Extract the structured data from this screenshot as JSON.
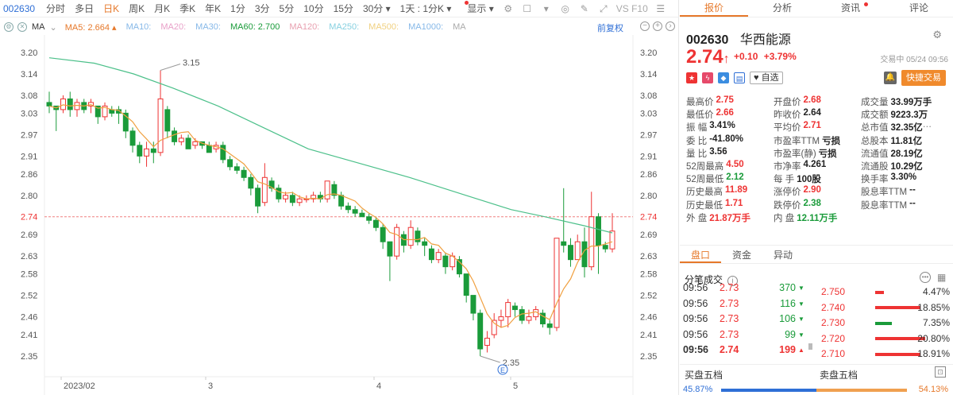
{
  "toolbar": {
    "code": "002630",
    "periods": [
      "分时",
      "多日",
      "日K",
      "周K",
      "月K",
      "季K",
      "年K",
      "1分",
      "3分",
      "5分",
      "10分",
      "15分",
      "30分"
    ],
    "active_period": "日K",
    "range_select": "1天 : 1分K",
    "display_label": "显示",
    "vs_label": "VS F10"
  },
  "ma_bar": {
    "ma_label": "MA",
    "items": [
      {
        "label": "MA5:",
        "value": "2.664",
        "color": "#e6782a"
      },
      {
        "label": "MA10:",
        "value": "",
        "color": "#86b8e8"
      },
      {
        "label": "MA20:",
        "value": "",
        "color": "#e8a0c8"
      },
      {
        "label": "MA30:",
        "value": "",
        "color": "#86b8e8"
      },
      {
        "label": "MA60:",
        "value": "2.700",
        "color": "#1a9b3a"
      },
      {
        "label": "MA120:",
        "value": "",
        "color": "#e8a0b0"
      },
      {
        "label": "MA250:",
        "value": "",
        "color": "#86d0e0"
      },
      {
        "label": "MA500:",
        "value": "",
        "color": "#f0d080"
      },
      {
        "label": "MA1000:",
        "value": "",
        "color": "#86b8e8"
      },
      {
        "label": "MA",
        "value": "",
        "color": "#aaa"
      }
    ],
    "fq_label": "前复权"
  },
  "chart_data": {
    "type": "candlestick",
    "y_ticks": [
      "3.20",
      "3.14",
      "3.08",
      "3.03",
      "2.97",
      "2.91",
      "2.86",
      "2.80",
      "2.74",
      "2.69",
      "2.63",
      "2.58",
      "2.52",
      "2.46",
      "2.41",
      "2.35"
    ],
    "x_ticks": [
      "2023/02",
      "3",
      "4",
      "5"
    ],
    "current_price": "2.74",
    "high_annotation": "3.15",
    "low_annotation": "2.35",
    "ma5_label": "MA5",
    "ma60_label": "MA60",
    "candles": [
      [
        3.06,
        3.05,
        3.03,
        3.09
      ],
      [
        3.05,
        3.04,
        2.98,
        3.05
      ],
      [
        3.04,
        3.07,
        3.03,
        3.08
      ],
      [
        3.07,
        3.04,
        3.02,
        3.09
      ],
      [
        3.04,
        3.06,
        3.02,
        3.07
      ],
      [
        3.06,
        3.04,
        3.03,
        3.07
      ],
      [
        3.05,
        3.06,
        3.03,
        3.07
      ],
      [
        3.05,
        3.02,
        3.0,
        3.05
      ],
      [
        3.02,
        3.05,
        3.01,
        3.06
      ],
      [
        3.04,
        3.03,
        3.02,
        3.05
      ],
      [
        3.04,
        3.03,
        3.0,
        3.05
      ],
      [
        3.03,
        2.98,
        2.96,
        3.04
      ],
      [
        2.98,
        2.94,
        2.92,
        2.99
      ],
      [
        2.94,
        2.91,
        2.89,
        2.95
      ],
      [
        2.91,
        2.93,
        2.88,
        2.95
      ],
      [
        2.93,
        2.92,
        2.89,
        2.95
      ],
      [
        2.92,
        3.07,
        2.91,
        3.15
      ],
      [
        3.04,
        2.98,
        2.96,
        3.05
      ],
      [
        2.98,
        2.95,
        2.94,
        2.99
      ],
      [
        2.95,
        2.96,
        2.94,
        2.97
      ],
      [
        2.96,
        2.93,
        2.93,
        2.97
      ],
      [
        2.94,
        2.95,
        2.93,
        2.96
      ],
      [
        2.95,
        2.94,
        2.93,
        2.95
      ],
      [
        2.94,
        2.92,
        2.92,
        2.95
      ],
      [
        2.93,
        2.94,
        2.92,
        2.95
      ],
      [
        2.94,
        2.9,
        2.89,
        2.95
      ],
      [
        2.9,
        2.88,
        2.87,
        2.91
      ],
      [
        2.88,
        2.87,
        2.86,
        2.89
      ],
      [
        2.87,
        2.85,
        2.84,
        2.88
      ],
      [
        2.85,
        2.82,
        2.8,
        2.86
      ],
      [
        2.82,
        2.77,
        2.75,
        2.83
      ],
      [
        2.78,
        2.85,
        2.77,
        2.89
      ],
      [
        2.84,
        2.82,
        2.81,
        2.85
      ],
      [
        2.82,
        2.79,
        2.78,
        2.83
      ],
      [
        2.79,
        2.8,
        2.78,
        2.81
      ],
      [
        2.8,
        2.78,
        2.77,
        2.81
      ],
      [
        2.78,
        2.79,
        2.77,
        2.8
      ],
      [
        2.79,
        2.79,
        2.78,
        2.8
      ],
      [
        2.79,
        2.8,
        2.78,
        2.81
      ],
      [
        2.8,
        2.79,
        2.78,
        2.81
      ],
      [
        2.79,
        2.84,
        2.78,
        2.84
      ],
      [
        2.83,
        2.8,
        2.79,
        2.84
      ],
      [
        2.8,
        2.77,
        2.76,
        2.81
      ],
      [
        2.77,
        2.76,
        2.75,
        2.78
      ],
      [
        2.76,
        2.75,
        2.74,
        2.77
      ],
      [
        2.75,
        2.74,
        2.74,
        2.76
      ],
      [
        2.74,
        2.73,
        2.72,
        2.75
      ],
      [
        2.73,
        2.71,
        2.7,
        2.74
      ],
      [
        2.71,
        2.67,
        2.65,
        2.72
      ],
      [
        2.67,
        2.63,
        2.56,
        2.67
      ],
      [
        2.63,
        2.71,
        2.62,
        2.72
      ],
      [
        2.69,
        2.66,
        2.64,
        2.7
      ],
      [
        2.66,
        2.71,
        2.65,
        2.73
      ],
      [
        2.7,
        2.67,
        2.66,
        2.71
      ],
      [
        2.67,
        2.66,
        2.63,
        2.68
      ],
      [
        2.65,
        2.62,
        2.61,
        2.66
      ],
      [
        2.62,
        2.64,
        2.61,
        2.65
      ],
      [
        2.63,
        2.6,
        2.58,
        2.64
      ],
      [
        2.6,
        2.63,
        2.59,
        2.64
      ],
      [
        2.62,
        2.58,
        2.57,
        2.63
      ],
      [
        2.58,
        2.52,
        2.5,
        2.58
      ],
      [
        2.52,
        2.47,
        2.45,
        2.52
      ],
      [
        2.47,
        2.37,
        2.35,
        2.48
      ],
      [
        2.38,
        2.4,
        2.36,
        2.42
      ],
      [
        2.41,
        2.45,
        2.4,
        2.47
      ],
      [
        2.45,
        2.46,
        2.43,
        2.48
      ],
      [
        2.46,
        2.5,
        2.43,
        2.51
      ],
      [
        2.49,
        2.48,
        2.46,
        2.5
      ],
      [
        2.48,
        2.45,
        2.44,
        2.49
      ],
      [
        2.45,
        2.46,
        2.44,
        2.48
      ],
      [
        2.46,
        2.48,
        2.45,
        2.49
      ],
      [
        2.47,
        2.44,
        2.43,
        2.48
      ],
      [
        2.44,
        2.43,
        2.41,
        2.45
      ],
      [
        2.43,
        2.68,
        2.42,
        2.68
      ],
      [
        2.67,
        2.66,
        2.64,
        2.82
      ],
      [
        2.66,
        2.62,
        2.6,
        2.68
      ],
      [
        2.62,
        2.67,
        2.62,
        2.69
      ],
      [
        2.67,
        2.6,
        2.57,
        2.71
      ],
      [
        2.6,
        2.74,
        2.59,
        2.81
      ],
      [
        2.74,
        2.66,
        2.58,
        2.75
      ],
      [
        2.66,
        2.65,
        2.64,
        2.67
      ],
      [
        2.65,
        2.7,
        2.64,
        2.75
      ]
    ]
  },
  "quote": {
    "code": "002630",
    "name": "华西能源",
    "price": "2.74",
    "change": "+0.10",
    "change_pct": "+3.79%",
    "trade_time": "交易中 05/24 09:56",
    "watch_label": "自选",
    "quick_trade_label": "快捷交易"
  },
  "right_tabs": [
    "报价",
    "分析",
    "资讯",
    "评论"
  ],
  "stats": [
    [
      {
        "l": "最高价",
        "v": "2.75",
        "c": "red"
      },
      {
        "l": "开盘价",
        "v": "2.68",
        "c": "red"
      },
      {
        "l": "成交量",
        "v": "33.99万手",
        "c": "dark"
      }
    ],
    [
      {
        "l": "最低价",
        "v": "2.66",
        "c": "red"
      },
      {
        "l": "昨收价",
        "v": "2.64",
        "c": "dark"
      },
      {
        "l": "成交额",
        "v": "9223.3万",
        "c": "dark"
      }
    ],
    [
      {
        "l": "振  幅",
        "v": "3.41%",
        "c": "dark"
      },
      {
        "l": "平均价",
        "v": "2.71",
        "c": "red"
      },
      {
        "l": "总市值",
        "v": "32.35亿",
        "c": "dark"
      }
    ],
    [
      {
        "l": "委  比",
        "v": "-41.80%",
        "c": "dark"
      },
      {
        "l": "市盈率TTM",
        "v": "亏损",
        "c": "dark"
      },
      {
        "l": "总股本",
        "v": "11.81亿",
        "c": "dark"
      }
    ],
    [
      {
        "l": "量  比",
        "v": "3.56",
        "c": "dark"
      },
      {
        "l": "市盈率(静)",
        "v": "亏损",
        "c": "dark"
      },
      {
        "l": "流通值",
        "v": "28.19亿",
        "c": "dark"
      }
    ],
    [
      {
        "l": "52周最高",
        "v": "4.50",
        "c": "red"
      },
      {
        "l": "市净率",
        "v": "4.261",
        "c": "dark"
      },
      {
        "l": "流通股",
        "v": "10.29亿",
        "c": "dark"
      }
    ],
    [
      {
        "l": "52周最低",
        "v": "2.12",
        "c": "green"
      },
      {
        "l": "每  手",
        "v": "100股",
        "c": "dark"
      },
      {
        "l": "换手率",
        "v": "3.30%",
        "c": "dark"
      }
    ],
    [
      {
        "l": "历史最高",
        "v": "11.89",
        "c": "red"
      },
      {
        "l": "涨停价",
        "v": "2.90",
        "c": "red"
      },
      {
        "l": "股息率TTM",
        "v": "--",
        "c": "dark"
      }
    ],
    [
      {
        "l": "历史最低",
        "v": "1.71",
        "c": "red"
      },
      {
        "l": "跌停价",
        "v": "2.38",
        "c": "green"
      },
      {
        "l": "股息率TTM",
        "v": "--",
        "c": "dark"
      }
    ],
    [
      {
        "l": "外  盘",
        "v": "21.87万手",
        "c": "red"
      },
      {
        "l": "内  盘",
        "v": "12.11万手",
        "c": "green"
      },
      {
        "l": "",
        "v": "",
        "c": "dark"
      }
    ]
  ],
  "sub_tabs": [
    "盘口",
    "资金",
    "异动"
  ],
  "fenbi": {
    "title": "分笔成交",
    "trades": [
      {
        "t": "09:56",
        "p": "2.73",
        "v": "370",
        "dir": "down"
      },
      {
        "t": "09:56",
        "p": "2.73",
        "v": "116",
        "dir": "down"
      },
      {
        "t": "09:56",
        "p": "2.73",
        "v": "106",
        "dir": "down"
      },
      {
        "t": "09:56",
        "p": "2.73",
        "v": "99",
        "dir": "down"
      },
      {
        "t": "09:56",
        "p": "2.74",
        "v": "199",
        "dir": "up"
      }
    ],
    "book": [
      {
        "p": "2.750",
        "pct": "4.47%",
        "frac": 0.12,
        "color": "#e33"
      },
      {
        "p": "2.740",
        "pct": "18.85%",
        "frac": 0.6,
        "color": "#e33"
      },
      {
        "p": "2.730",
        "pct": "7.35%",
        "frac": 0.22,
        "color": "#1a9b3a"
      },
      {
        "p": "2.720",
        "pct": "20.80%",
        "frac": 0.66,
        "color": "#e33"
      },
      {
        "p": "2.710",
        "pct": "18.91%",
        "frac": 0.6,
        "color": "#e33"
      }
    ]
  },
  "five": {
    "buy_label": "买盘五档",
    "sell_label": "卖盘五档",
    "buy_ratio": "45.87%",
    "sell_ratio": "54.13%"
  }
}
